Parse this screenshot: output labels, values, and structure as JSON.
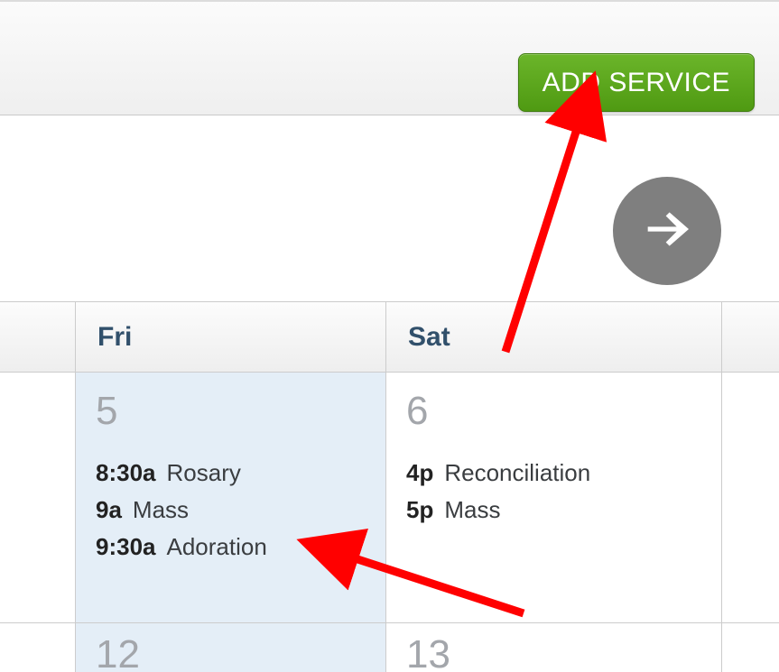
{
  "toolbar": {
    "add_service_label": "ADD SERVICE"
  },
  "calendar": {
    "day_headers": {
      "fri": "Fri",
      "sat": "Sat"
    },
    "week1": {
      "fri": {
        "daynum": "5",
        "events": [
          {
            "time": "8:30a",
            "name": "Rosary"
          },
          {
            "time": "9a",
            "name": "Mass"
          },
          {
            "time": "9:30a",
            "name": "Adoration"
          }
        ]
      },
      "sat": {
        "daynum": "6",
        "events": [
          {
            "time": "4p",
            "name": "Reconciliation"
          },
          {
            "time": "5p",
            "name": "Mass"
          }
        ]
      }
    },
    "week2": {
      "fri": {
        "daynum": "12"
      },
      "sat": {
        "daynum": "13"
      }
    }
  }
}
